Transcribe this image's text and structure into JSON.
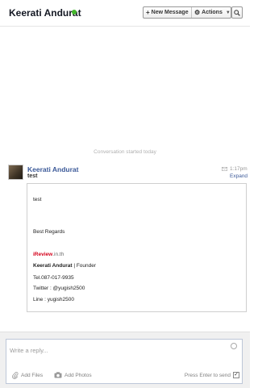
{
  "header": {
    "contact_name": "Keerati Andurat",
    "new_message_label": "New Message",
    "actions_label": "Actions",
    "online_color": "#42b72a"
  },
  "conversation": {
    "started_text": "Conversation started today"
  },
  "message": {
    "author": "Keerati Andurat",
    "subject": "test",
    "time": "1:17pm",
    "expand_label": "Expand",
    "body": {
      "line1": "test",
      "regards": "Best Regards",
      "brand_part1": "iReview",
      "brand_part2": ".in.th",
      "sig_name": "Keerati Andurat",
      "sig_role": " | Founder",
      "tel": "Tel.087-017-9935",
      "twitter": "Twitter : @yugish2500",
      "line": "Line : yugish2500"
    }
  },
  "composer": {
    "placeholder": "Write a reply...",
    "add_files_label": "Add Files",
    "add_photos_label": "Add Photos",
    "enter_hint": "Press Enter to send",
    "enter_checked": true
  },
  "colors": {
    "link": "#3b5998",
    "brand_red": "#d4001a"
  }
}
